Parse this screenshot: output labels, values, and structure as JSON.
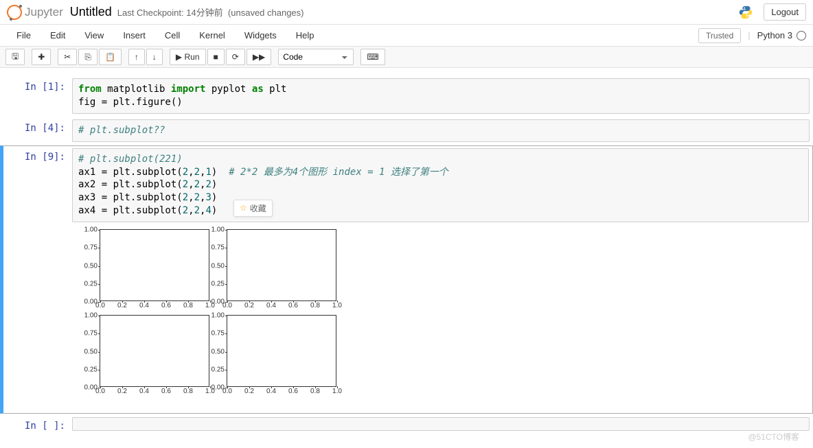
{
  "header": {
    "logo_text": "Jupyter",
    "title": "Untitled",
    "checkpoint": "Last Checkpoint: 14分钟前",
    "unsaved": "(unsaved changes)",
    "logout": "Logout"
  },
  "menu": {
    "items": [
      "File",
      "Edit",
      "View",
      "Insert",
      "Cell",
      "Kernel",
      "Widgets",
      "Help"
    ],
    "trusted": "Trusted",
    "kernel": "Python 3"
  },
  "toolbar": {
    "save": "💾",
    "add": "✚",
    "cut": "✂",
    "copy": "📋",
    "paste": "📄",
    "up": "↑",
    "down": "↓",
    "run": "▶ Run",
    "stop": "■",
    "restart": "⟳",
    "ff": "▶▶",
    "celltype": "Code",
    "cmd": "⌘"
  },
  "cells": [
    {
      "prompt": "In  [1]:",
      "code_html": "<span class='kw-green'>from</span> matplotlib <span class='kw-green'>import</span> pyplot <span class='kw-green'>as</span> plt\nfig = plt.figure()"
    },
    {
      "prompt": "In  [4]:",
      "code_html": "<span class='comment-cyan'># plt.subplot??</span>"
    },
    {
      "prompt": "In  [9]:",
      "code_html": "<span class='comment-cyan'># plt.subplot(221)</span>\nax1 = plt.subplot(<span class='num'>2</span>,<span class='num'>2</span>,<span class='num'>1</span>)  <span class='comment-cyan'># 2*2 最多为4个图形 index = 1 选择了第一个</span>\nax2 = plt.subplot(<span class='num'>2</span>,<span class='num'>2</span>,<span class='num'>2</span>)\nax3 = plt.subplot(<span class='num'>2</span>,<span class='num'>2</span>,<span class='num'>3</span>)\nax4 = plt.subplot(<span class='num'>2</span>,<span class='num'>2</span>,<span class='num'>4</span>)"
    },
    {
      "prompt": "In  [ ]:",
      "code_html": ""
    }
  ],
  "chart_data": [
    {
      "type": "line",
      "title": "",
      "xlabel": "",
      "ylabel": "",
      "xlim": [
        0.0,
        1.0
      ],
      "ylim": [
        0.0,
        1.0
      ],
      "x_ticks": [
        0.0,
        0.2,
        0.4,
        0.6,
        0.8,
        1.0
      ],
      "y_ticks": [
        0.0,
        0.25,
        0.5,
        0.75,
        1.0
      ],
      "series": []
    },
    {
      "type": "line",
      "title": "",
      "xlabel": "",
      "ylabel": "",
      "xlim": [
        0.0,
        1.0
      ],
      "ylim": [
        0.0,
        1.0
      ],
      "x_ticks": [
        0.0,
        0.2,
        0.4,
        0.6,
        0.8,
        1.0
      ],
      "y_ticks": [
        0.0,
        0.25,
        0.5,
        0.75,
        1.0
      ],
      "series": []
    },
    {
      "type": "line",
      "title": "",
      "xlabel": "",
      "ylabel": "",
      "xlim": [
        0.0,
        1.0
      ],
      "ylim": [
        0.0,
        1.0
      ],
      "x_ticks": [
        0.0,
        0.2,
        0.4,
        0.6,
        0.8,
        1.0
      ],
      "y_ticks": [
        0.0,
        0.25,
        0.5,
        0.75,
        1.0
      ],
      "series": []
    },
    {
      "type": "line",
      "title": "",
      "xlabel": "",
      "ylabel": "",
      "xlim": [
        0.0,
        1.0
      ],
      "ylim": [
        0.0,
        1.0
      ],
      "x_ticks": [
        0.0,
        0.2,
        0.4,
        0.6,
        0.8,
        1.0
      ],
      "y_ticks": [
        0.0,
        0.25,
        0.5,
        0.75,
        1.0
      ],
      "series": []
    }
  ],
  "bookmark": "收藏",
  "watermark": "@51CTO博客"
}
